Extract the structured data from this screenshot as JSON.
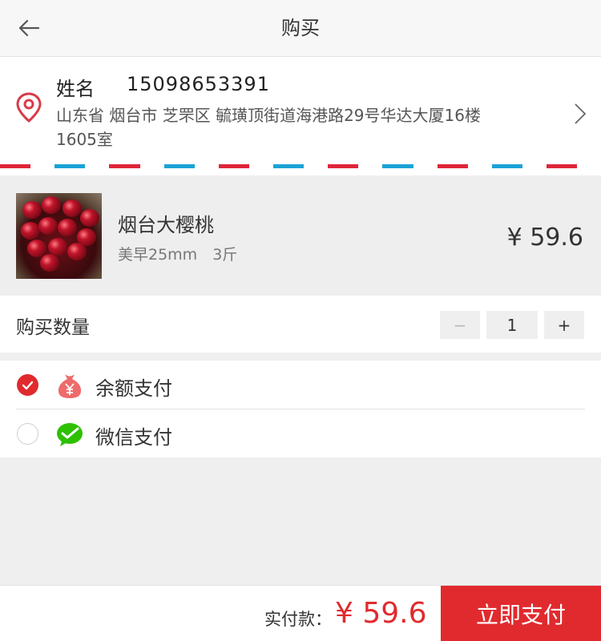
{
  "header": {
    "title": "购买",
    "back_icon": "arrow-left-icon"
  },
  "address": {
    "name": "姓名",
    "phone": "15098653391",
    "line": "山东省 烟台市 芝罘区 毓璜顶街道海港路29号华达大厦16楼1605室",
    "pin_icon": "location-pin-icon",
    "stripe_colors": [
      "#e0253a",
      "#1aa3d6"
    ]
  },
  "product": {
    "name": "烟台大樱桃",
    "spec": "美早25mm　3斤",
    "price": "¥ 59.6"
  },
  "quantity": {
    "label": "购买数量",
    "minus": "−",
    "value": "1",
    "plus": "+"
  },
  "payment": {
    "options": [
      {
        "label": "余额支付",
        "icon": "money-bag-icon",
        "selected": true
      },
      {
        "label": "微信支付",
        "icon": "wechat-icon",
        "selected": false
      }
    ]
  },
  "footer": {
    "total_label": "实付款：",
    "total_amount": "¥ 59.6",
    "pay_button": "立即支付"
  },
  "colors": {
    "accent": "#e02a2e",
    "wechat": "#2dc100"
  }
}
